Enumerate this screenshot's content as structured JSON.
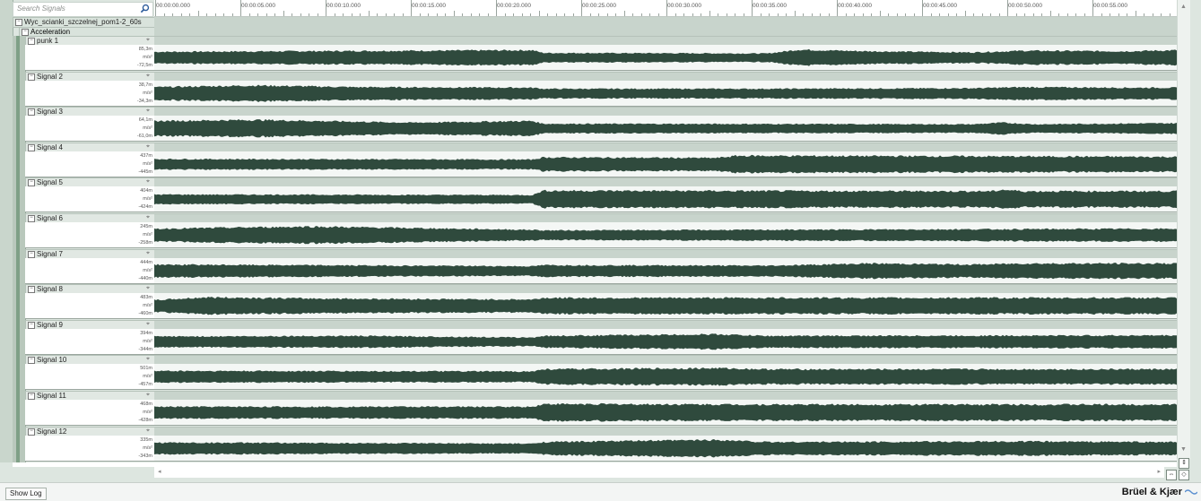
{
  "search": {
    "placeholder": "Search Signals"
  },
  "tree": {
    "root_label": "Wyc_scianki_szczelnej_pom1-2_60s",
    "group_label": "Acceleration"
  },
  "timeline": {
    "ticks": [
      "00:00:00.000",
      "00:00:05.000",
      "00:00:10.000",
      "00:00:15.000",
      "00:00:20.000",
      "00:00:25.000",
      "00:00:30.000",
      "00:00:35.000",
      "00:00:40.000",
      "00:00:45.000",
      "00:00:50.000",
      "00:00:55.000"
    ]
  },
  "tracks": [
    {
      "name": "punk 1",
      "max": "85,3m",
      "unit": "m/s²",
      "min": "-72,5m"
    },
    {
      "name": "Signal 2",
      "max": "38,7m",
      "unit": "m/s²",
      "min": "-34,3m"
    },
    {
      "name": "Signal 3",
      "max": "64,1m",
      "unit": "m/s²",
      "min": "-61,0m"
    },
    {
      "name": "Signal 4",
      "max": "437m",
      "unit": "m/s²",
      "min": "-445m"
    },
    {
      "name": "Signal 5",
      "max": "404m",
      "unit": "m/s²",
      "min": "-424m"
    },
    {
      "name": "Signal 6",
      "max": "245m",
      "unit": "m/s²",
      "min": "-258m"
    },
    {
      "name": "Signal 7",
      "max": "444m",
      "unit": "m/s²",
      "min": "-440m"
    },
    {
      "name": "Signal 8",
      "max": "483m",
      "unit": "m/s²",
      "min": "-460m"
    },
    {
      "name": "Signal 9",
      "max": "394m",
      "unit": "m/s²",
      "min": "-344m"
    },
    {
      "name": "Signal 10",
      "max": "501m",
      "unit": "m/s²",
      "min": "-457m"
    },
    {
      "name": "Signal 11",
      "max": "468m",
      "unit": "m/s²",
      "min": "-428m"
    },
    {
      "name": "Signal 12",
      "max": "335m",
      "unit": "m/s²",
      "min": "-343m"
    }
  ],
  "footer": {
    "show_log_label": "Show Log",
    "brand": "Brüel & Kjær"
  },
  "colors": {
    "waveform": "#2f4a3d",
    "accent_green": "#7fa087"
  }
}
